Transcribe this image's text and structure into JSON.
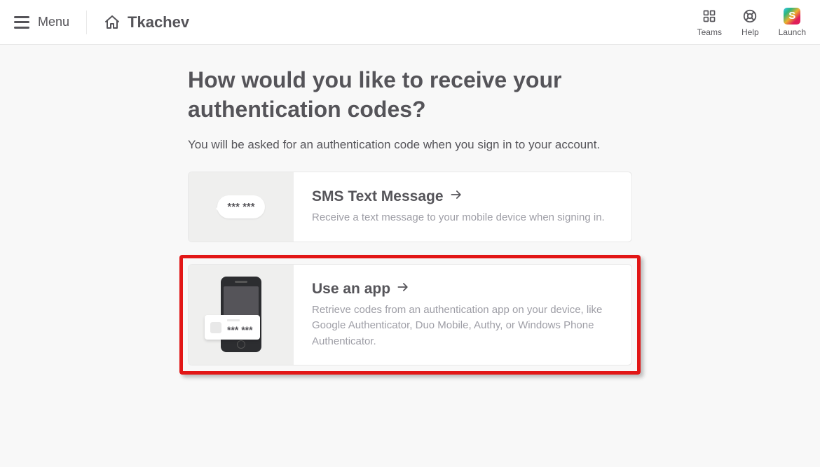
{
  "header": {
    "menu_label": "Menu",
    "team_name": "Tkachev",
    "nav": {
      "teams": "Teams",
      "help": "Help",
      "launch": "Launch"
    }
  },
  "main": {
    "title": "How would you like to receive your authentication codes?",
    "subtitle": "You will be asked for an authentication code when you sign in to your account."
  },
  "options": {
    "sms": {
      "title": "SMS Text Message",
      "desc": "Receive a text message to your mobile device when signing in.",
      "bubble_text": "*** ***"
    },
    "app": {
      "title": "Use an app",
      "desc": "Retrieve codes from an authentication app on your device, like Google Authenticator, Duo Mobile, Authy, or Windows Phone Authenticator.",
      "bubble_text": "*** ***"
    }
  }
}
